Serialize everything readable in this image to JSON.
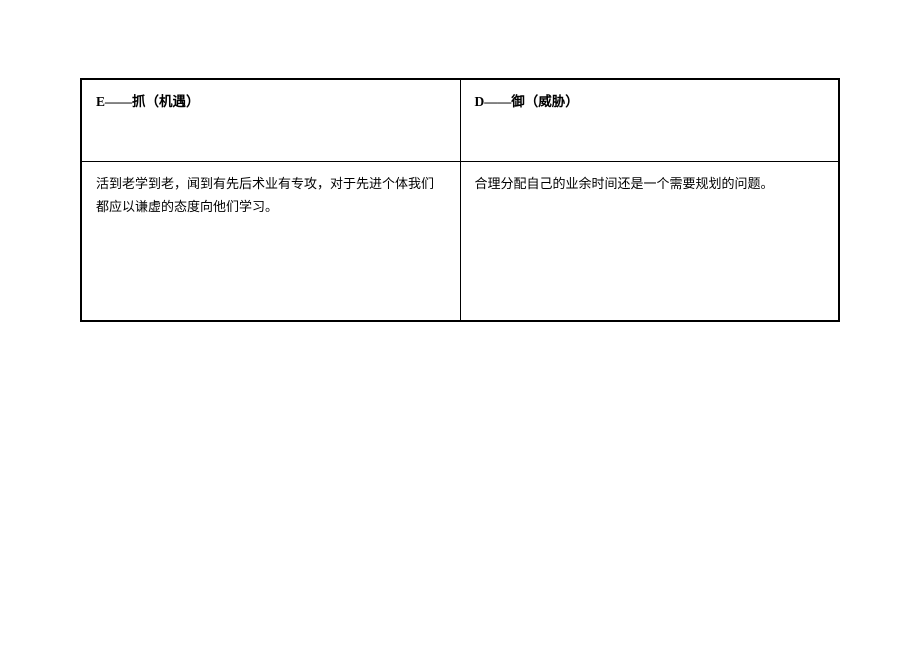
{
  "table": {
    "headers": {
      "left": "E——抓（机遇）",
      "right": "D——御（威胁）"
    },
    "content": {
      "left": "活到老学到老，闻到有先后术业有专攻，对于先进个体我们都应以谦虚的态度向他们学习。",
      "right": "合理分配自己的业余时间还是一个需要规划的问题。"
    }
  }
}
